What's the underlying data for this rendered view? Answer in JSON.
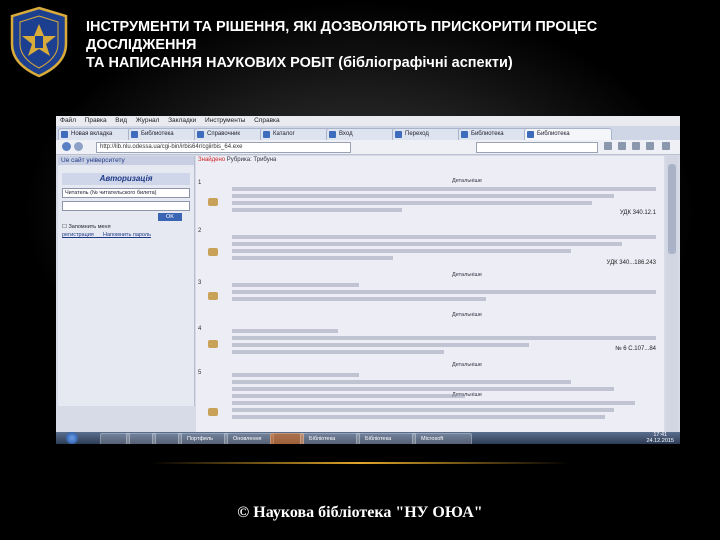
{
  "title_line1": "ІНСТРУМЕНТИ ТА РІШЕННЯ, ЯКІ ДОЗВОЛЯЮТЬ ПРИСКОРИТИ ПРОЦЕС ДОСЛІДЖЕННЯ",
  "title_line2": "ТА НАПИСАННЯ НАУКОВИХ РОБІТ",
  "title_line2_suffix": " (бібліографічні аспекти)",
  "footer": "© Наукова бібліотека \"НУ ОЮА\"",
  "colors": {
    "background": "#000000",
    "accent_line": "#e0a52a",
    "logo_blue": "#1d3f8f",
    "logo_gold": "#d9ab3a"
  },
  "screenshot": {
    "menu": [
      "Файл",
      "Правка",
      "Вид",
      "Журнал",
      "Закладки",
      "Инструменты",
      "Справка"
    ],
    "tabs": [
      "Новая вкладка",
      "Библиотека",
      "Справочник",
      "Каталог",
      "Вход",
      "Переход",
      "Библиотека",
      "Библиотека"
    ],
    "url": "http://lib.nlu.odessa.ua/cgi-bin/irbis64r/cgiirbis_64.exe",
    "left_panel": {
      "header": "Ue сайт університету",
      "auth": "Авторизація",
      "login_placeholder": "Читатель (№ читательского билета)",
      "ok": "OK",
      "remember": "Запомнить меня",
      "register": "регистрация",
      "forgot": "Напомнить пароль"
    },
    "result_header_label": "Знайдено",
    "result_header_query": "Рубрика: Трибуна",
    "records": [
      {
        "num": "1",
        "code": "УДК 340.12.1",
        "more": "Детальніше"
      },
      {
        "num": "2",
        "code": "УДК 340...186.243",
        "more": "Детальніше"
      },
      {
        "num": "3",
        "code": "",
        "more": "Детальніше"
      },
      {
        "num": "4",
        "code": "№ 6 С.107...84",
        "more": "Детальніше"
      },
      {
        "num": "5",
        "code": "",
        "more": "Детальніше"
      }
    ],
    "taskbar": {
      "buttons": [
        "",
        "",
        "",
        "Портфель",
        "Оновлення",
        "",
        "Бібліотека",
        "Бібліотека",
        "Microsoft"
      ],
      "clock_time": "17:41",
      "clock_date": "24.12.2015"
    }
  }
}
